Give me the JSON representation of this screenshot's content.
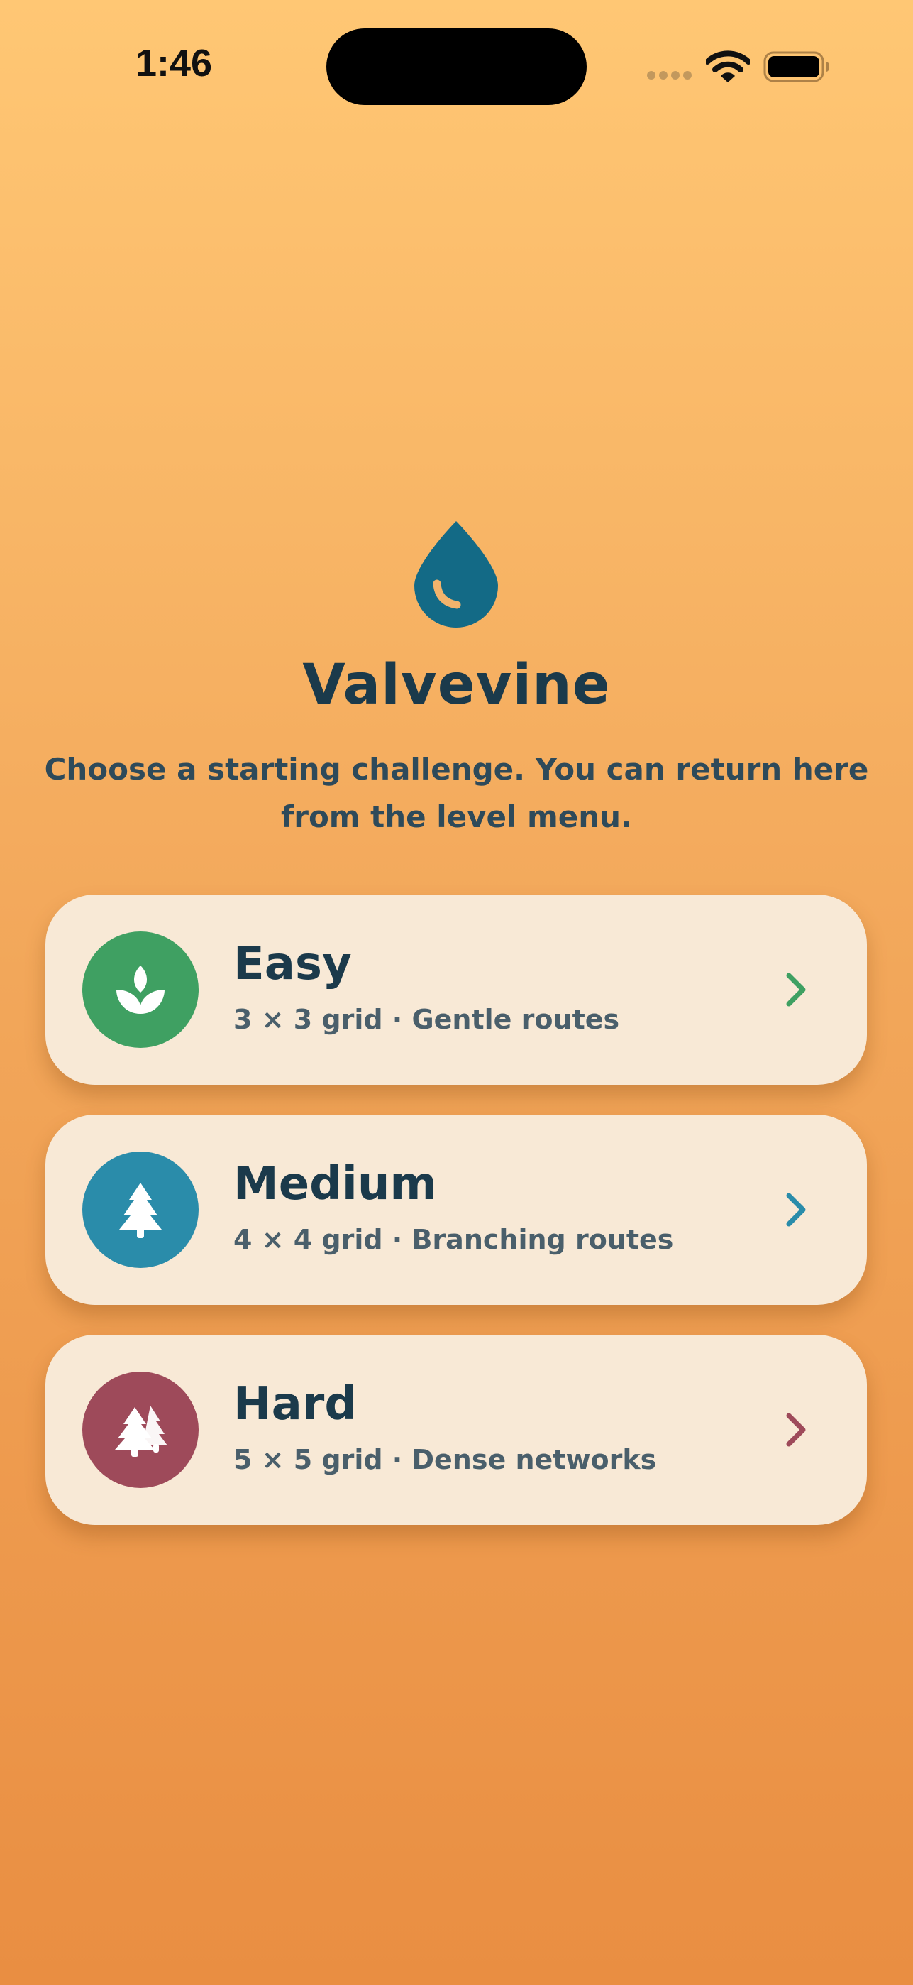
{
  "status_bar": {
    "time": "1:46"
  },
  "app": {
    "title": "Valvevine",
    "subtitle": "Choose a starting challenge. You can return here from the level menu.",
    "logo_icon": "water-drop-icon",
    "logo_color": "#136A86"
  },
  "levels": [
    {
      "title": "Easy",
      "detail": "3 × 3 grid · Gentle routes",
      "icon": "sprout-icon",
      "color": "#3FA062"
    },
    {
      "title": "Medium",
      "detail": "4 × 4 grid · Branching routes",
      "icon": "tree-icon",
      "color": "#2A8CAA"
    },
    {
      "title": "Hard",
      "detail": "5 × 5 grid · Dense networks",
      "icon": "forest-icon",
      "color": "#9E4A5A"
    }
  ],
  "colors": {
    "background_top": "#FFC774",
    "background_bottom": "#E98E42",
    "card_background": "#F8E9D6",
    "title_text": "#1B3A4B"
  }
}
